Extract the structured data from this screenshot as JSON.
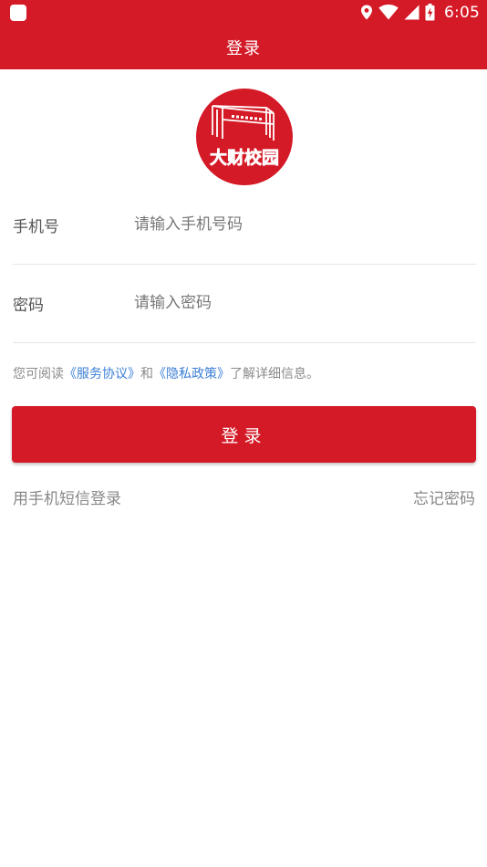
{
  "status_bar": {
    "time": "6:05",
    "icons": [
      "app-icon",
      "location-icon",
      "wifi-icon",
      "cellular-signal-icon",
      "battery-charging-icon"
    ]
  },
  "app_bar": {
    "title": "登录"
  },
  "logo": {
    "icon": "campus-logo-icon",
    "text": "大财校园"
  },
  "form": {
    "phone": {
      "label": "手机号",
      "value": "",
      "placeholder": "请输入手机号码"
    },
    "password": {
      "label": "密码",
      "value": "",
      "placeholder": "请输入密码"
    }
  },
  "agreement": {
    "prefix": "您可阅读",
    "service_link": "《服务协议》",
    "conjunction": "和",
    "privacy_link": "《隐私政策》",
    "suffix": "了解详细信息。"
  },
  "login_button": {
    "label": "登录"
  },
  "links": {
    "sms_login": "用手机短信登录",
    "forgot_password": "忘记密码"
  },
  "colors": {
    "brand_red": "#D41A27",
    "link_blue": "#3D7FD6"
  }
}
